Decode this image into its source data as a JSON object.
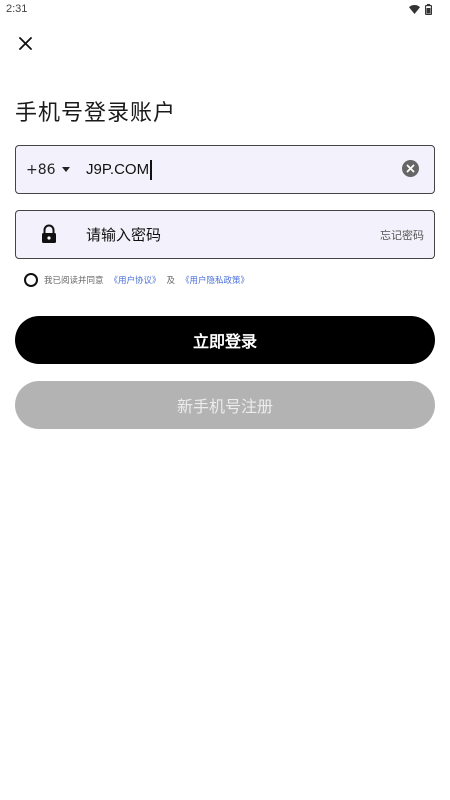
{
  "status_bar": {
    "time": "2:31",
    "icons": [
      "wifi-icon",
      "battery-icon"
    ]
  },
  "header": {
    "close_icon": "close-icon",
    "title": "手机号登录账户"
  },
  "phone_field": {
    "country_code": "+86",
    "value": "J9P.COM",
    "clear_icon": "clear-icon"
  },
  "password_field": {
    "lock_icon": "lock-icon",
    "placeholder": "请输入密码",
    "forgot_label": "忘记密码"
  },
  "agreement": {
    "prefix": "我已阅读并同意",
    "user_agreement": "《用户协议》",
    "and": "及",
    "privacy_policy": "《用户隐私政策》",
    "checked": false
  },
  "actions": {
    "login_label": "立即登录",
    "register_label": "新手机号注册"
  },
  "colors": {
    "field_background": "#f3f1fb",
    "login_button": "#000000",
    "register_button": "#b3b3b3",
    "link": "#4a6fd8"
  }
}
